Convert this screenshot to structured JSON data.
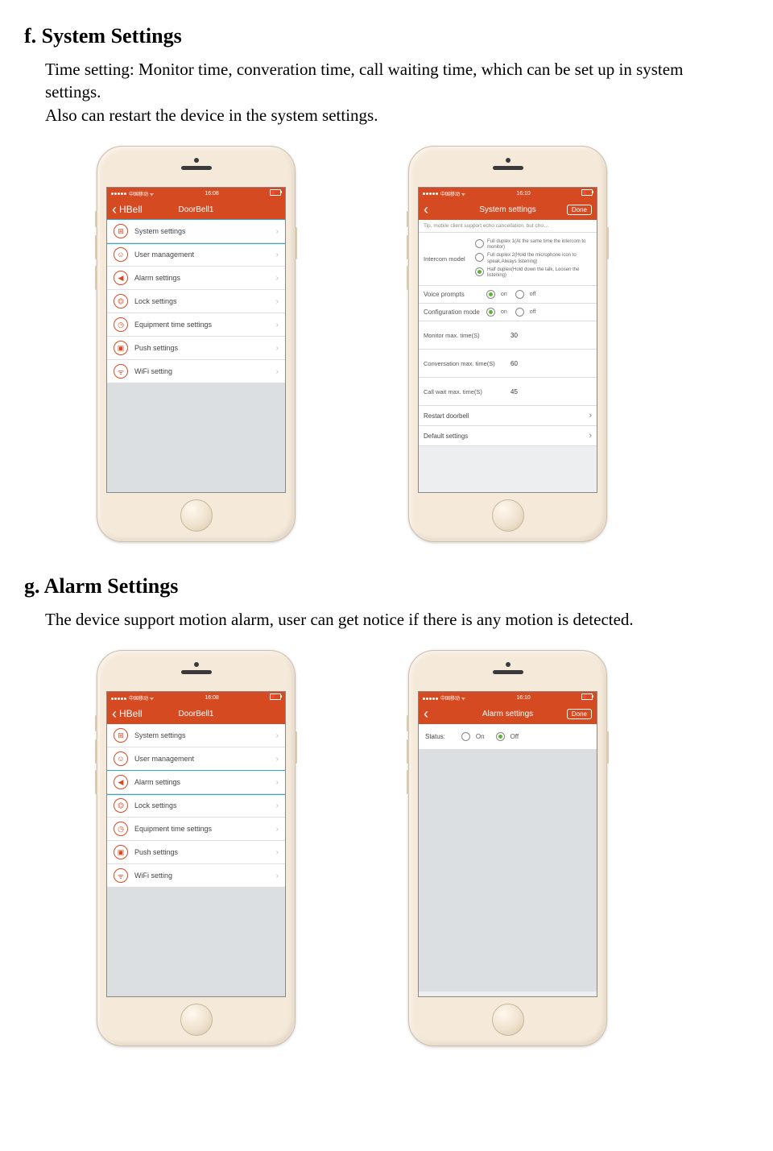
{
  "sectionF": {
    "heading": "f. System Settings",
    "body1": "Time setting: Monitor time, converation time, call waiting time, which can be set up in system settings.",
    "body2": "Also can restart the device in the system settings."
  },
  "sectionG": {
    "heading": "g. Alarm Settings",
    "body": "The device support motion alarm, user can get notice if there is any motion is detected."
  },
  "status": {
    "carrier": "●●●●● 中国移动",
    "wifi": "⌃",
    "time1": "16:08",
    "time2": "16:10"
  },
  "menuScreen": {
    "back": "HBell",
    "title": "DoorBell1",
    "items": [
      {
        "label": "System settings"
      },
      {
        "label": "User management"
      },
      {
        "label": "Alarm settings"
      },
      {
        "label": "Lock settings"
      },
      {
        "label": "Equipment time settings"
      },
      {
        "label": "Push settings"
      },
      {
        "label": "WiFi setting"
      }
    ]
  },
  "sysSettings": {
    "title": "System settings",
    "done": "Done",
    "tip": "Tip, mobile client support echo cancellation, but cho…",
    "intercomLabel": "Intercom model",
    "intercomOptions": [
      "Full duplex 1(At the same time the intercom to monitor)",
      "Full duplex 2(Hold the microphone icon to speak,Always listening)",
      "Half duplex(Hold down the talk, Loosen the listening)"
    ],
    "voicePrompts": "Voice prompts",
    "configMode": "Configuration mode",
    "on": "on",
    "off": "off",
    "monitorMax": {
      "label": "Monitor max. time(S)",
      "value": "30"
    },
    "convMax": {
      "label": "Conversation max. time(S)",
      "value": "60"
    },
    "callWait": {
      "label": "Call wait max. time(S)",
      "value": "45"
    },
    "restart": "Restart doorbell",
    "defaultSettings": "Default settings"
  },
  "alarmSettings": {
    "title": "Alarm settings",
    "done": "Done",
    "statusLabel": "Status:",
    "on": "On",
    "off": "Off"
  }
}
